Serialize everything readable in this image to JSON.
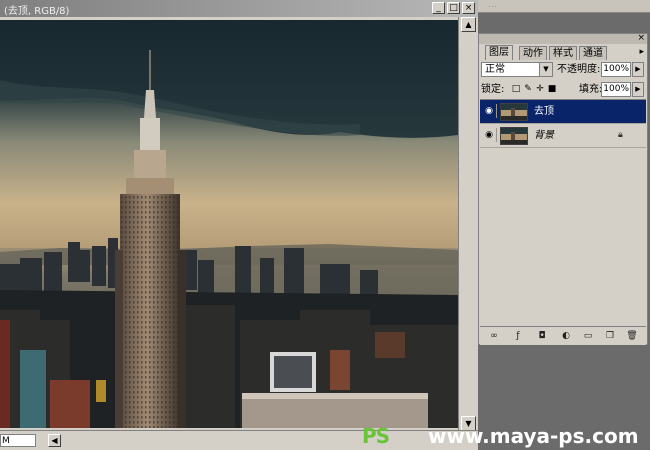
{
  "document": {
    "title": "(去顶, RGB/8)",
    "zoom": "M",
    "buttons": {
      "minimize": "_",
      "maximize": "□",
      "close": "×"
    }
  },
  "top_panel": {
    "text": "…"
  },
  "layers_panel": {
    "close_glyph": "×",
    "tabs": [
      {
        "label": "图层",
        "active": true
      },
      {
        "label": "动作",
        "active": false
      },
      {
        "label": "样式",
        "active": false
      },
      {
        "label": "通道",
        "active": false
      }
    ],
    "tab_menu_glyph": "▸",
    "blend_mode": "正常",
    "opacity_label": "不透明度:",
    "opacity": "100%",
    "lock_label": "锁定:",
    "fill_label": "填充:",
    "fill": "100%",
    "layers": [
      {
        "name": "去顶",
        "selected": true,
        "locked": false
      },
      {
        "name": "背景",
        "selected": false,
        "locked": true
      }
    ],
    "bottom_icons": [
      "link-icon",
      "layer-style-icon",
      "mask-icon",
      "adjustment-icon",
      "folder-icon",
      "new-layer-icon",
      "trash-icon"
    ]
  },
  "watermark": {
    "logo": "PS",
    "text": "www.maya-ps.com"
  },
  "colors": {
    "selection": "#0a246a",
    "panel": "#d4d0c8",
    "watermark_green": "#6ac43a"
  }
}
